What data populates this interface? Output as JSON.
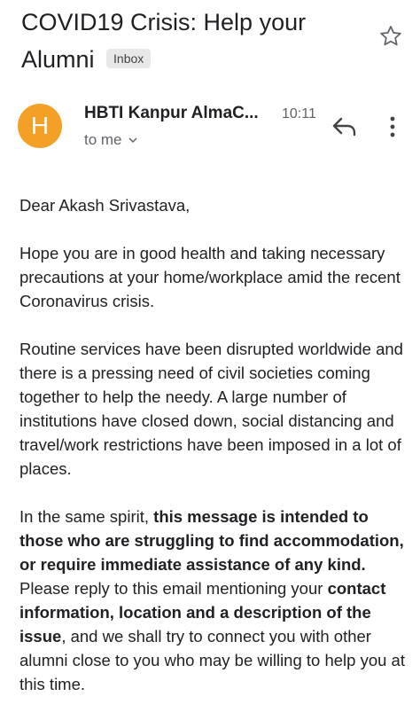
{
  "email": {
    "subject": "COVID19 Crisis: Help your Alumni",
    "label": "Inbox",
    "sender_name": "HBTI Kanpur AlmaC...",
    "time": "10:11",
    "recipient": "to me",
    "avatar_letter": "H"
  },
  "icons": {
    "star": "star-outline-icon",
    "reply": "reply-icon",
    "more": "more-vert-icon",
    "expand": "chevron-down-icon"
  },
  "colors": {
    "avatar": "#f4a026"
  },
  "body": {
    "greeting": "Dear Akash Srivastava,",
    "para1": "Hope you are in good health and taking necessary precautions at your home/workplace amid the recent Coronavirus crisis.",
    "para2": "Routine services have been disrupted worldwide and there is a pressing need of civil societies coming together to help the needy. A large number of institutions have closed down, social distancing and travel/work restrictions have been imposed in a lot of places.",
    "para3_a": "In the same spirit, ",
    "para3_b": "this message is intended to those who are struggling to find accommodation, or require immediate assistance of any kind.",
    "para3_c": " Please reply to this email mentioning your ",
    "para3_d": "contact information, location and a description of the issue",
    "para3_e": ", and we shall try to connect you with other alumni close to you who may be willing to help you at this time."
  }
}
